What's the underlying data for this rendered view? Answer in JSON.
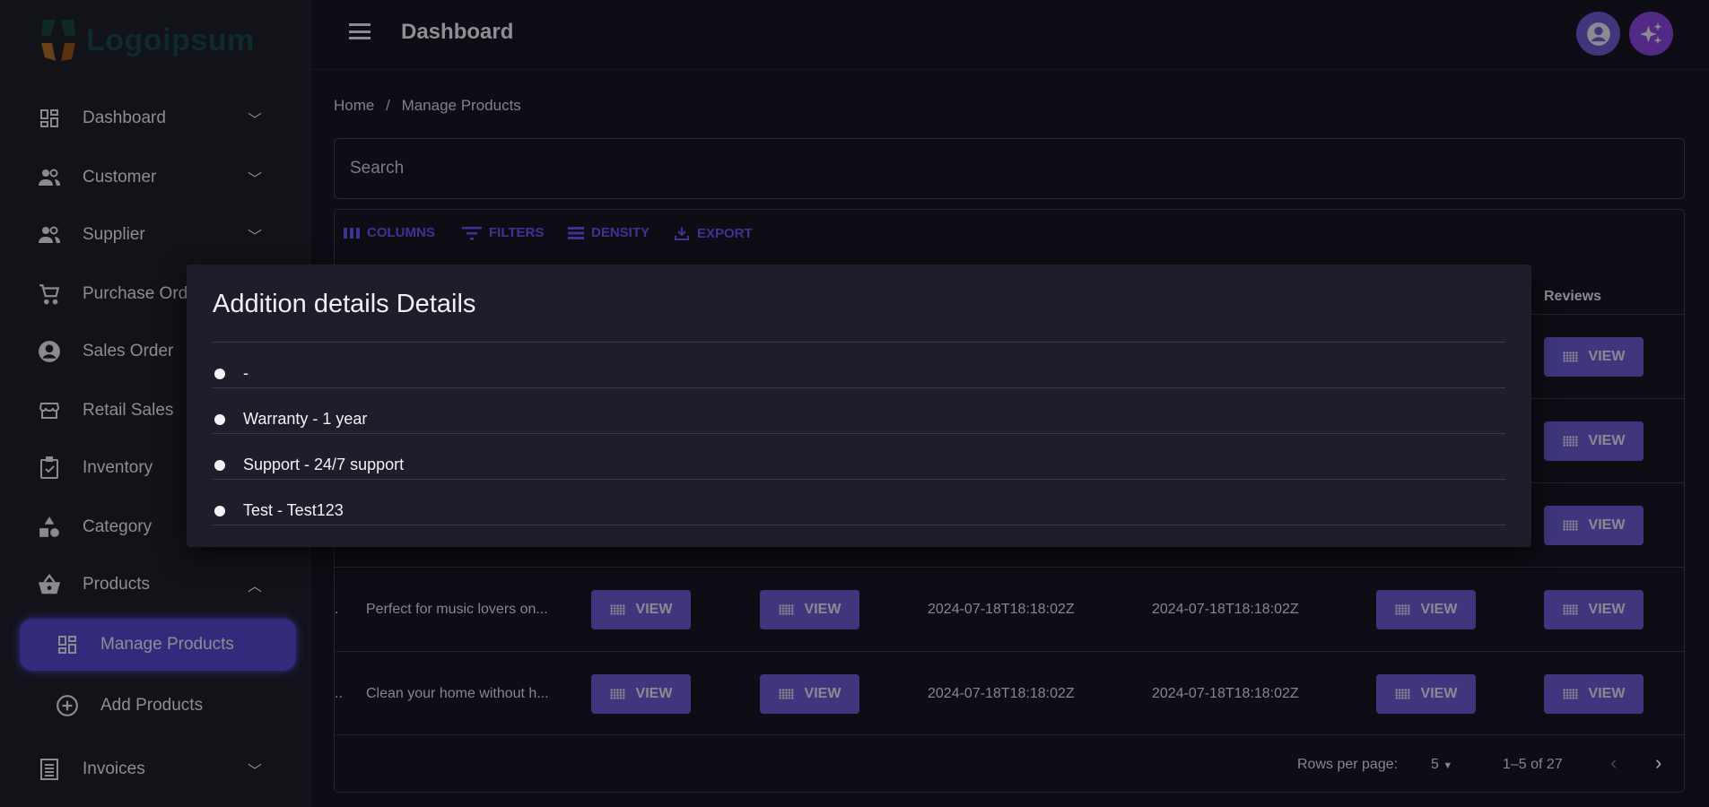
{
  "logo": {
    "text": "Logoipsum"
  },
  "sidebar": {
    "items": [
      {
        "label": "Dashboard",
        "icon": "dashboard-icon",
        "chevron": "down"
      },
      {
        "label": "Customer",
        "icon": "people-icon",
        "chevron": "down"
      },
      {
        "label": "Supplier",
        "icon": "people-icon",
        "chevron": "down"
      },
      {
        "label": "Purchase Order",
        "icon": "cart-icon",
        "chevron": "down"
      },
      {
        "label": "Sales Order",
        "icon": "account-circle-icon",
        "chevron": "down"
      },
      {
        "label": "Retail Sales",
        "icon": "store-icon",
        "chevron": "down"
      },
      {
        "label": "Inventory",
        "icon": "clipboard-check-icon",
        "chevron": "down"
      },
      {
        "label": "Category",
        "icon": "shapes-icon",
        "chevron": "down"
      },
      {
        "label": "Products",
        "icon": "basket-icon",
        "chevron": "up"
      },
      {
        "label": "Manage Products",
        "icon": "dashboard-icon",
        "active": true
      },
      {
        "label": "Add Products",
        "icon": "add-circle-icon"
      },
      {
        "label": "Invoices",
        "icon": "receipt-icon",
        "chevron": "down"
      }
    ]
  },
  "header": {
    "title": "Dashboard"
  },
  "breadcrumb": {
    "home": "Home",
    "sep": "/",
    "current": "Manage Products"
  },
  "search": {
    "placeholder": "Search"
  },
  "toolbar": {
    "columns": "COLUMNS",
    "filters": "FILTERS",
    "density": "DENSITY",
    "export": "EXPORT"
  },
  "table": {
    "visible_header": "Reviews",
    "view_label": "VIEW",
    "rows": [
      {
        "description": "",
        "created": "",
        "updated": ""
      },
      {
        "description": "",
        "created": "",
        "updated": ""
      },
      {
        "description": "",
        "created": "",
        "updated": ""
      },
      {
        "prev": ".",
        "description": "Perfect for music lovers on...",
        "created": "2024-07-18T18:18:02Z",
        "updated": "2024-07-18T18:18:02Z"
      },
      {
        "prev": "...",
        "description": "Clean your home without h...",
        "created": "2024-07-18T18:18:02Z",
        "updated": "2024-07-18T18:18:02Z"
      }
    ]
  },
  "pagination": {
    "rows_per_page_label": "Rows per page:",
    "rows_per_page": "5",
    "range": "1–5 of 27"
  },
  "modal": {
    "title": "Addition details Details",
    "items": [
      "-",
      "Warranty - 1 year",
      "Support - 24/7 support",
      "Test - Test123"
    ]
  },
  "colors": {
    "accent": "#3f367e",
    "active_nav": "#342a7c",
    "avatar": "#3f367e",
    "ai_button": "#522a85"
  }
}
